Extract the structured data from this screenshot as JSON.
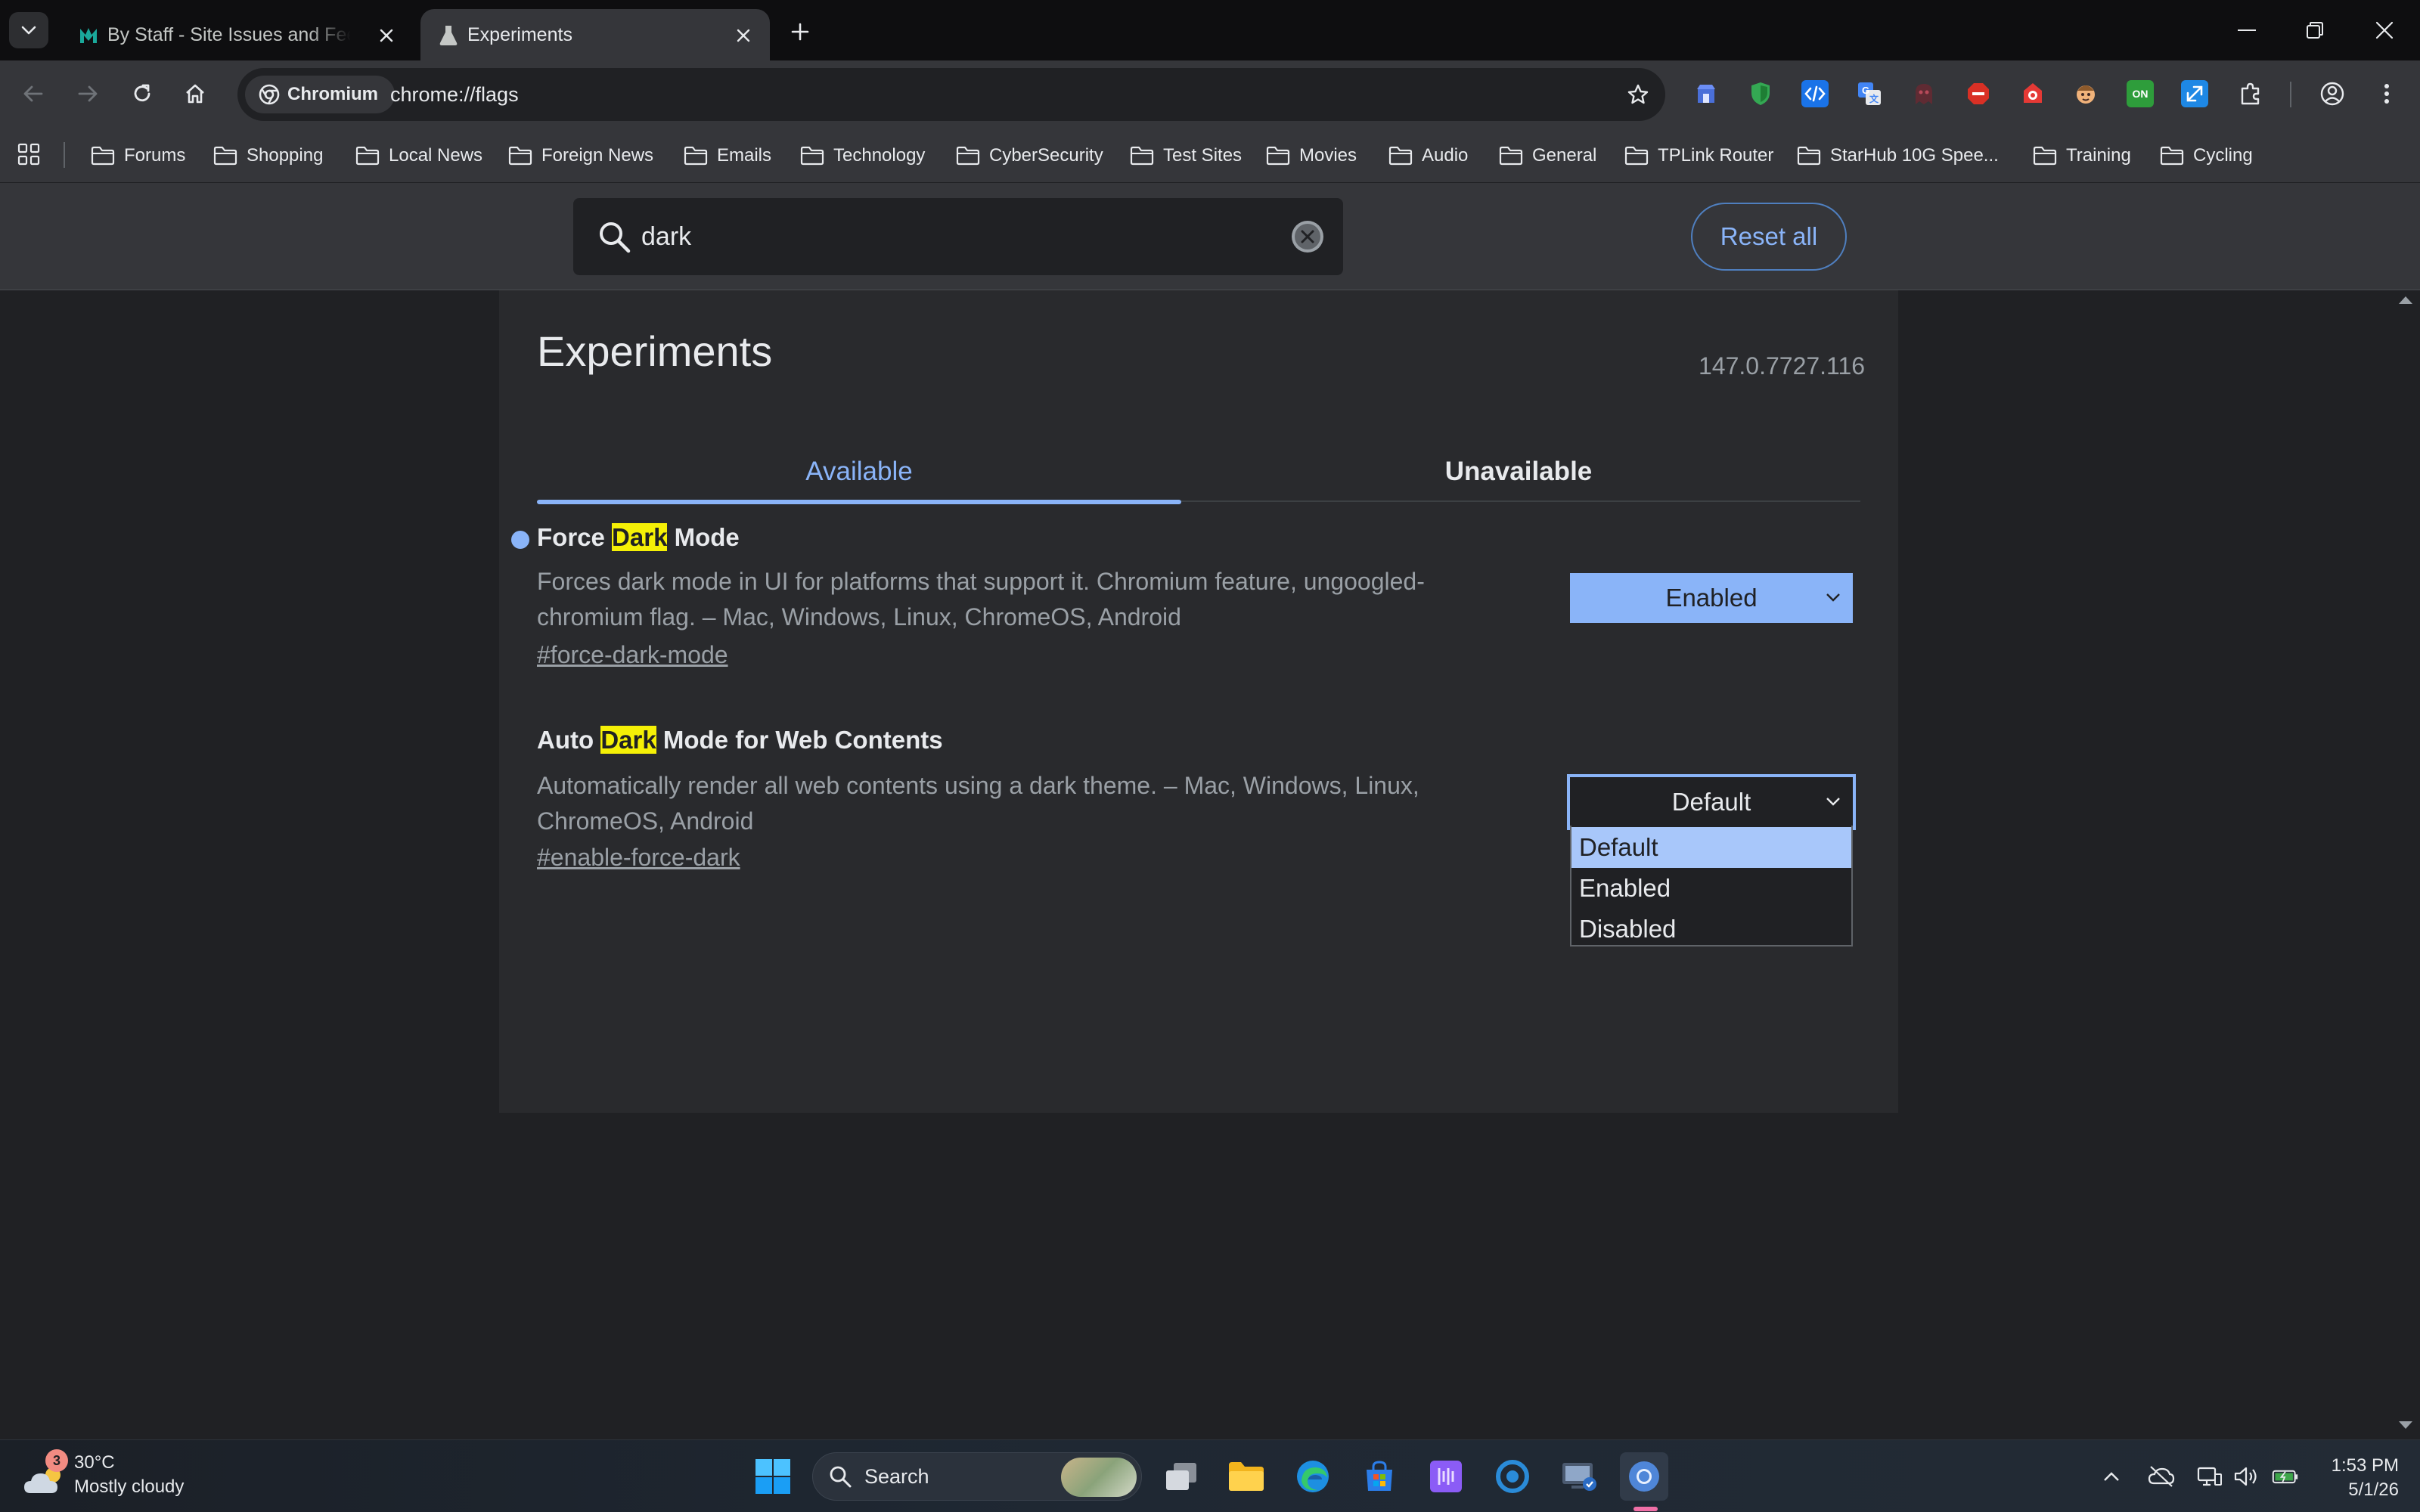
{
  "browser": {
    "tabs": [
      {
        "title": "By Staff - Site Issues and Feedback",
        "active": false
      },
      {
        "title": "Experiments",
        "active": true
      }
    ],
    "omnibox": {
      "site_chip": "Chromium",
      "url": "chrome://flags"
    },
    "extensions": [
      "ext-store-icon",
      "shield-icon",
      "code-icon",
      "translate-icon",
      "ghost-icon",
      "block-icon",
      "ext-red-icon",
      "face-icon",
      "on-badge-icon",
      "resize-icon",
      "puzzle-icon"
    ],
    "ext_on_label": "ON"
  },
  "bookmarks": [
    "Forums",
    "Shopping",
    "Local News",
    "Foreign News",
    "Emails",
    "Technology",
    "CyberSecurity",
    "Test Sites",
    "Movies",
    "Audio",
    "General",
    "TPLink Router",
    "StarHub 10G Spee...",
    "Training",
    "Cycling"
  ],
  "flags_page": {
    "search_value": "dark",
    "reset_label": "Reset all",
    "title": "Experiments",
    "version": "147.0.7727.116",
    "tabs": {
      "available": "Available",
      "unavailable": "Unavailable"
    },
    "flags": [
      {
        "title_before": "Force ",
        "title_highlight": "Dark",
        "title_after": " Mode",
        "description": "Forces dark mode in UI for platforms that support it. Chromium feature, ungoogled-chromium flag. – Mac, Windows, Linux, ChromeOS, Android",
        "link": "#force-dark-mode",
        "value": "Enabled",
        "modified": true
      },
      {
        "title_before": "Auto ",
        "title_highlight": "Dark",
        "title_after": " Mode for Web Contents",
        "description": "Automatically render all web contents using a dark theme. – Mac, Windows, Linux, ChromeOS, Android",
        "link": "#enable-force-dark",
        "value": "Default",
        "modified": false
      }
    ],
    "dropdown_options": [
      "Default",
      "Enabled",
      "Disabled"
    ],
    "dropdown_selected": "Default"
  },
  "taskbar": {
    "weather": {
      "badge": "3",
      "temp": "30°C",
      "condition": "Mostly cloudy"
    },
    "search_label": "Search",
    "clock": {
      "time": "1:53 PM",
      "date": "5/1/26"
    }
  },
  "colors": {
    "accent": "#8ab4f8",
    "highlight": "#f5f006",
    "background": "#202124",
    "panel": "#292a2d"
  }
}
